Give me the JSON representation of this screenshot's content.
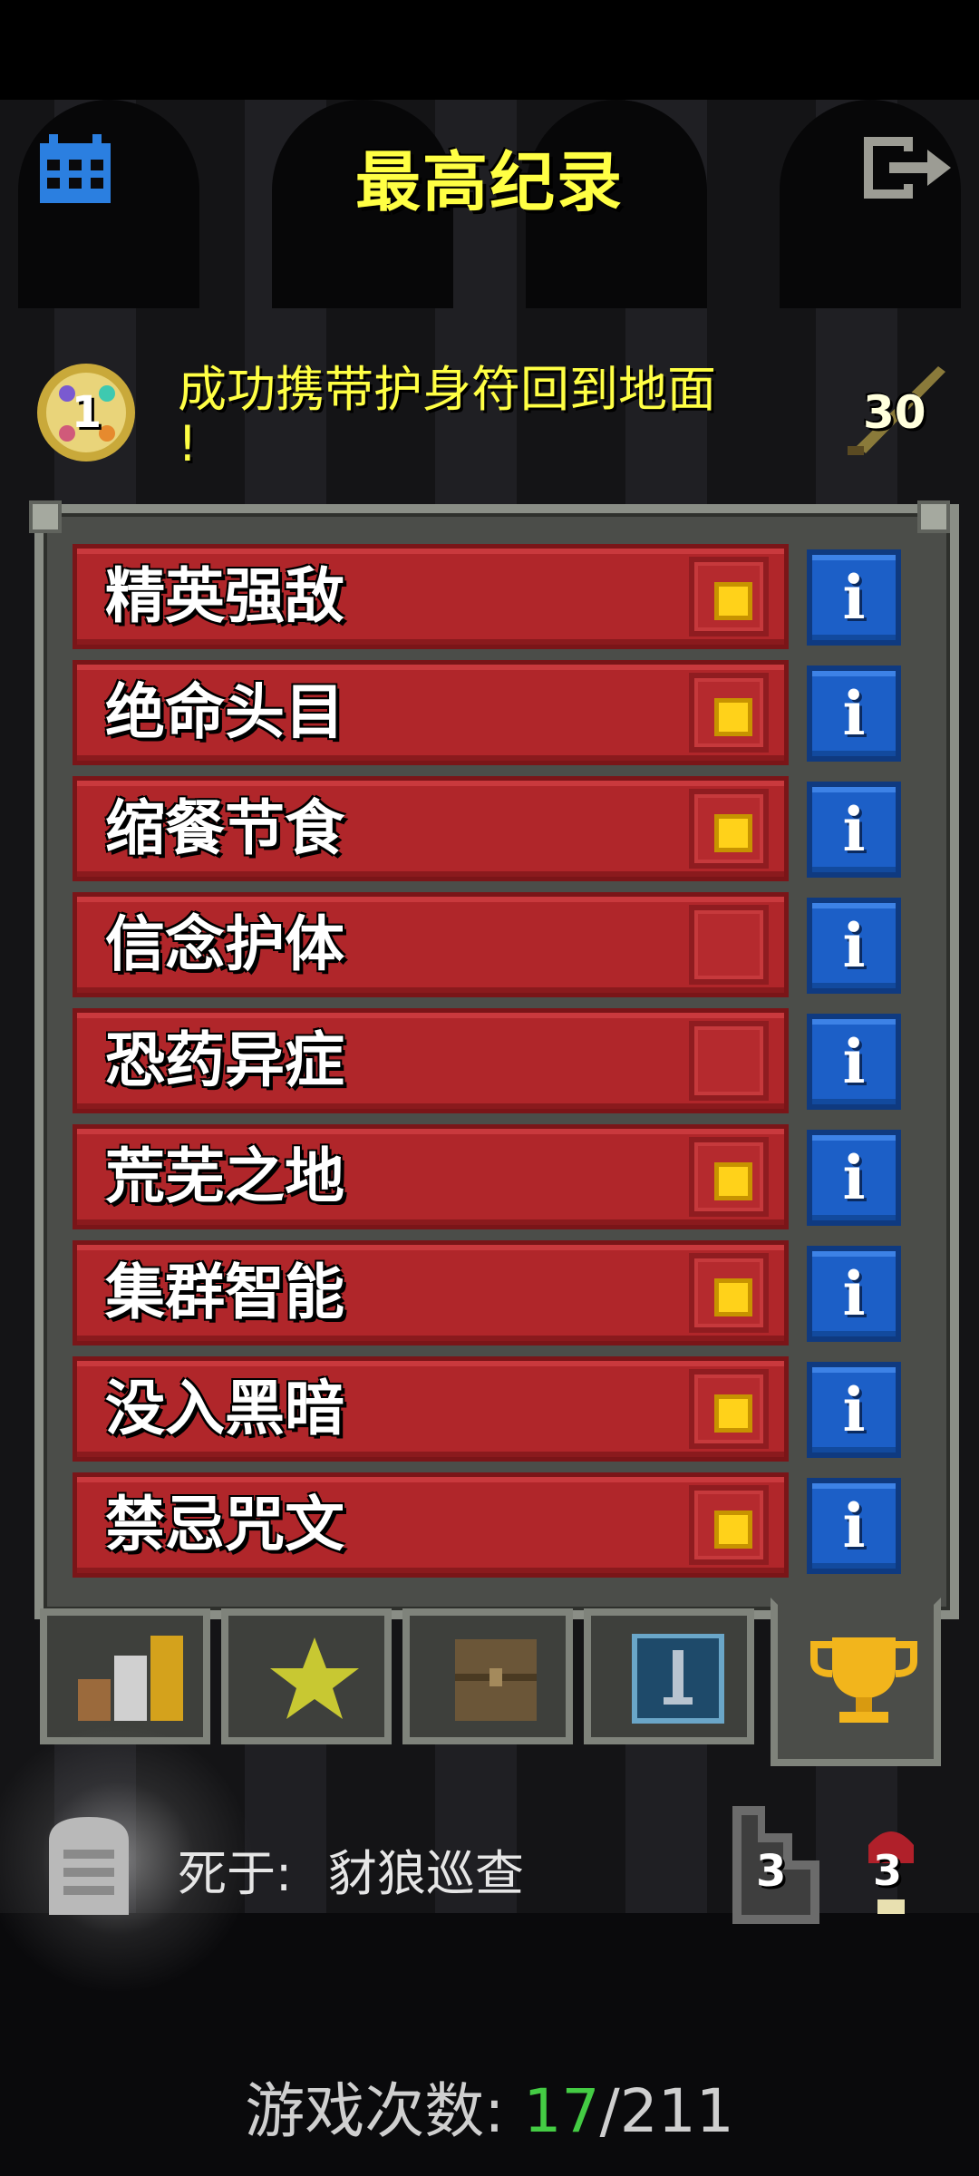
{
  "header": {
    "title": "最高纪录",
    "calendar_icon": "calendar-icon",
    "exit_icon": "exit-icon"
  },
  "challenge_summary": {
    "badge_count": "1",
    "text": "成功携带护身符回到地面！",
    "text_line1": "成功携带护身符回到地面",
    "text_line2": "!",
    "weapon_level": "30"
  },
  "challenges": [
    {
      "label": "精英强敌",
      "checked": true
    },
    {
      "label": "绝命头目",
      "checked": true
    },
    {
      "label": "缩餐节食",
      "checked": true
    },
    {
      "label": "信念护体",
      "checked": false
    },
    {
      "label": "恐药异症",
      "checked": false
    },
    {
      "label": "荒芜之地",
      "checked": true
    },
    {
      "label": "集群智能",
      "checked": true
    },
    {
      "label": "没入黑暗",
      "checked": true
    },
    {
      "label": "禁忌咒文",
      "checked": true
    }
  ],
  "tabs": [
    {
      "icon": "stats-bars-icon",
      "active": false
    },
    {
      "icon": "star-icon",
      "active": false
    },
    {
      "icon": "chest-icon",
      "active": false
    },
    {
      "icon": "sword-card-icon",
      "active": false
    },
    {
      "icon": "trophy-icon",
      "active": true
    }
  ],
  "record": {
    "death_label": "死于:",
    "death_cause": "豺狼巡查",
    "depth": "3",
    "level": "3"
  },
  "footer": {
    "games_label": "游戏次数:",
    "games_current": "17",
    "games_total": "/211"
  },
  "colors": {
    "title_yellow": "#ffff44",
    "row_red": "#b0262a",
    "info_blue": "#1c5fc7",
    "check_gold": "#ffd21a",
    "games_current_green": "#44cc44"
  }
}
